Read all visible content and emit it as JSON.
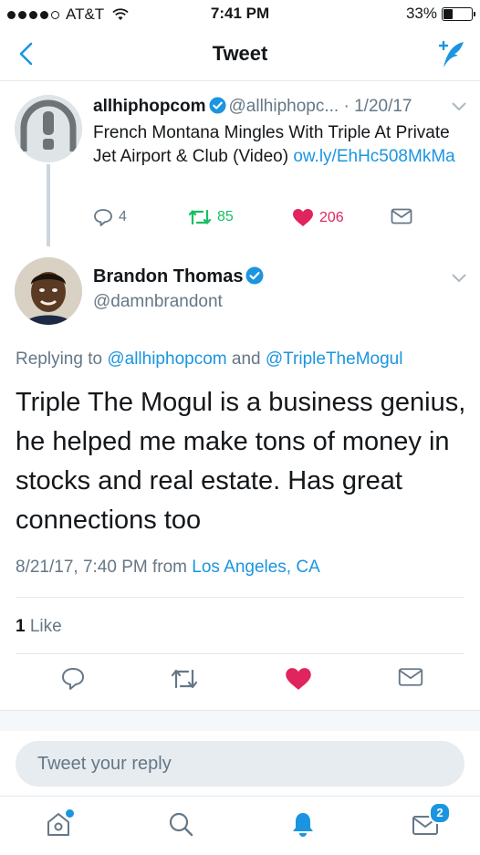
{
  "status_bar": {
    "carrier": "AT&T",
    "time": "7:41 PM",
    "battery": "33%"
  },
  "nav": {
    "title": "Tweet"
  },
  "parent_tweet": {
    "name": "allhiphopcom",
    "handle": "@allhiphopc...",
    "separator": " · ",
    "date": "1/20/17",
    "text": "French Montana Mingles With Triple At Private Jet Airport & Club (Video) ",
    "link": "ow.ly/EhHc508MkMa",
    "replies": "4",
    "retweets": "85",
    "likes": "206"
  },
  "tweet": {
    "name": "Brandon Thomas",
    "handle": "@damnbrandont",
    "replying_prefix": "Replying to ",
    "replying_user1": "@allhiphopcom",
    "replying_and": " and ",
    "replying_user2": "@TripleTheMogul",
    "text": "Triple The Mogul is a business genius, he helped me make tons of money in stocks and real estate. Has great connections too",
    "timestamp": "8/21/17, 7:40 PM",
    "from_label": " from ",
    "location": "Los Angeles, CA",
    "like_count": "1",
    "like_label": " Like"
  },
  "reply": {
    "placeholder": "Tweet your reply"
  },
  "tabbar": {
    "messages_badge": "2"
  },
  "colors": {
    "accent": "#1b95e0",
    "like": "#e0245e",
    "retweet": "#17bf63",
    "text": "#14171a",
    "muted": "#657786"
  },
  "icons": [
    "back-chevron-icon",
    "compose-icon",
    "verified-icon",
    "chevron-down-icon",
    "reply-icon",
    "retweet-icon",
    "heart-icon",
    "message-icon",
    "home-icon",
    "search-icon",
    "notifications-icon"
  ]
}
